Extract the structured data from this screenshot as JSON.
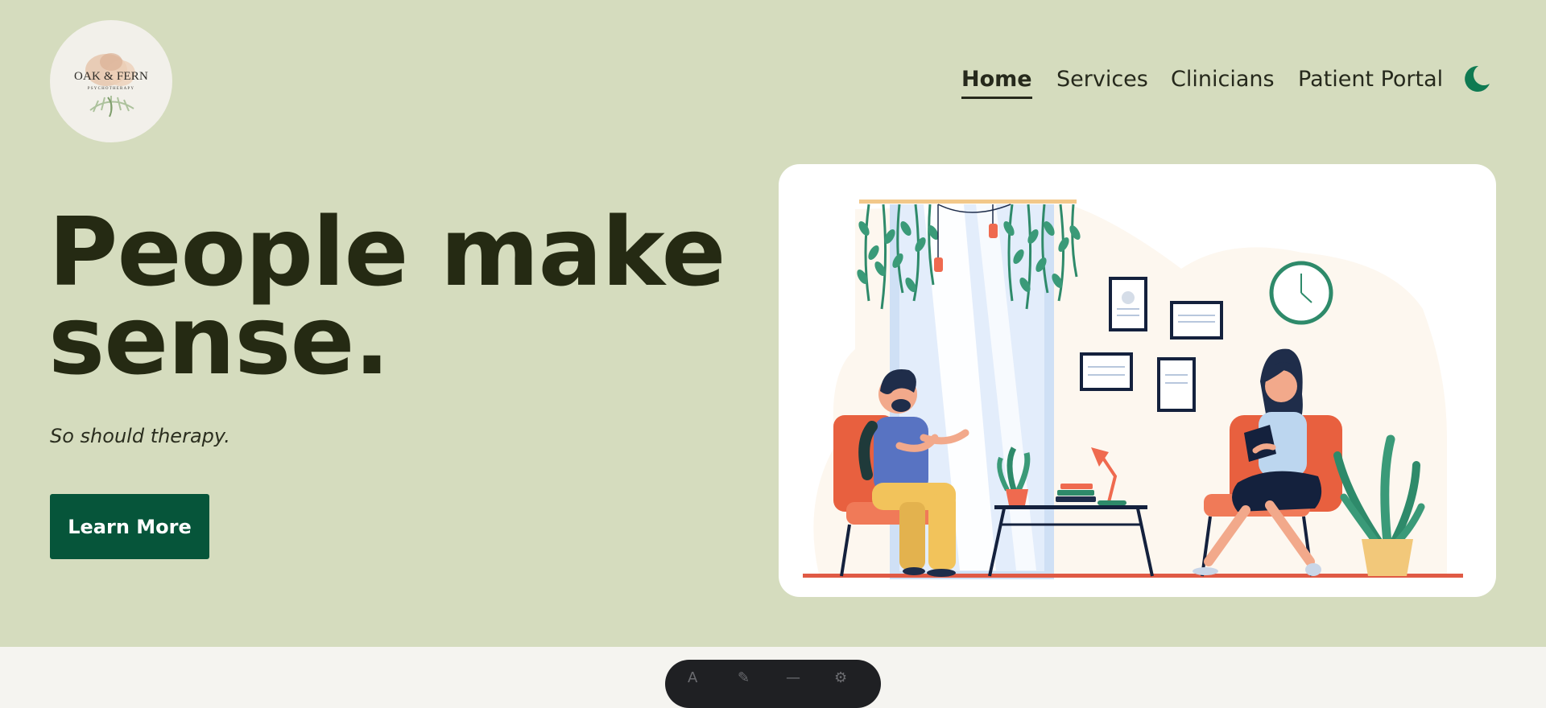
{
  "brand": {
    "name": "OAK & FERN",
    "subtitle": "PSYCHOTHERAPY"
  },
  "nav": {
    "items": [
      {
        "label": "Home",
        "active": true
      },
      {
        "label": "Services"
      },
      {
        "label": "Clinicians"
      },
      {
        "label": "Patient Portal"
      }
    ],
    "theme_toggle_icon": "moon-icon"
  },
  "hero": {
    "headline_line1": "People make",
    "headline_line2": "sense.",
    "tagline": "So should therapy.",
    "cta_label": "Learn More",
    "illustration": "therapy-session-illustration"
  },
  "colors": {
    "hero_background": "#d5dcbe",
    "headline": "#252a13",
    "cta_background": "#06553a",
    "accent_green": "#1a7a55",
    "page_background": "#f5f4f0"
  }
}
